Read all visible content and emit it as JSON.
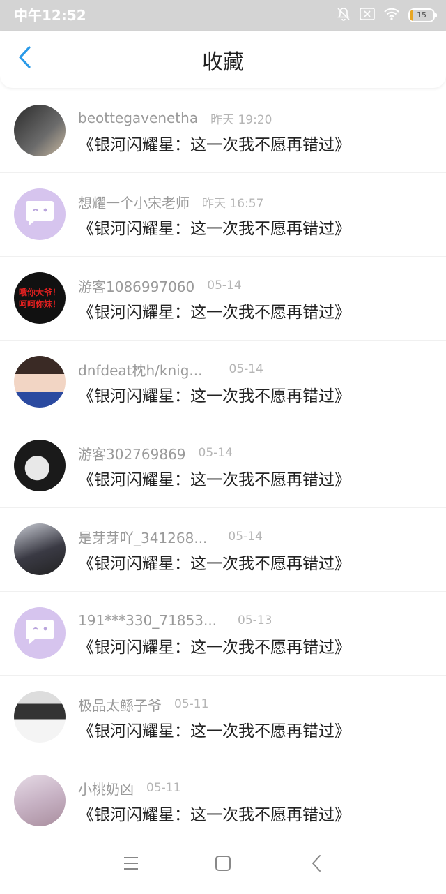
{
  "status_bar": {
    "time": "中午12:52",
    "battery": "15",
    "battery_level": 0.15,
    "icons": [
      "mute-bell-icon",
      "no-sim-icon",
      "wifi-icon",
      "battery-icon"
    ]
  },
  "header": {
    "title": "收藏",
    "back_icon": "chevron-left-icon",
    "accent_color": "#2a9ae8"
  },
  "favorites": [
    {
      "username": "beottegavenetha",
      "time": "昨天 19:20",
      "title": "《银河闪耀星：这一次我不愿再错过》"
    },
    {
      "username": "想耀一个小宋老师",
      "time": "昨天 16:57",
      "title": "《银河闪耀星：这一次我不愿再错过》"
    },
    {
      "username": "游客1086997060",
      "time": "05-14",
      "title": "《银河闪耀星：这一次我不愿再错过》",
      "avatar_text": [
        "哦你大爷！",
        "呵呵你妹！"
      ]
    },
    {
      "username": "dnfdeat枕h/knig...",
      "time": "05-14",
      "title": "《银河闪耀星：这一次我不愿再错过》"
    },
    {
      "username": "游客302769869",
      "time": "05-14",
      "title": "《银河闪耀星：这一次我不愿再错过》"
    },
    {
      "username": "是芽芽吖_341268...",
      "time": "05-14",
      "title": "《银河闪耀星：这一次我不愿再错过》"
    },
    {
      "username": "191***330_71853...",
      "time": "05-13",
      "title": "《银河闪耀星：这一次我不愿再错过》"
    },
    {
      "username": "极品太鲧子爷",
      "time": "05-11",
      "title": "《银河闪耀星：这一次我不愿再错过》"
    },
    {
      "username": "小桃奶凶",
      "time": "05-11",
      "title": "《银河闪耀星：这一次我不愿再错过》"
    }
  ],
  "system_nav": {
    "icons": [
      "menu-icon",
      "home-square-icon",
      "back-triangle-icon"
    ]
  }
}
